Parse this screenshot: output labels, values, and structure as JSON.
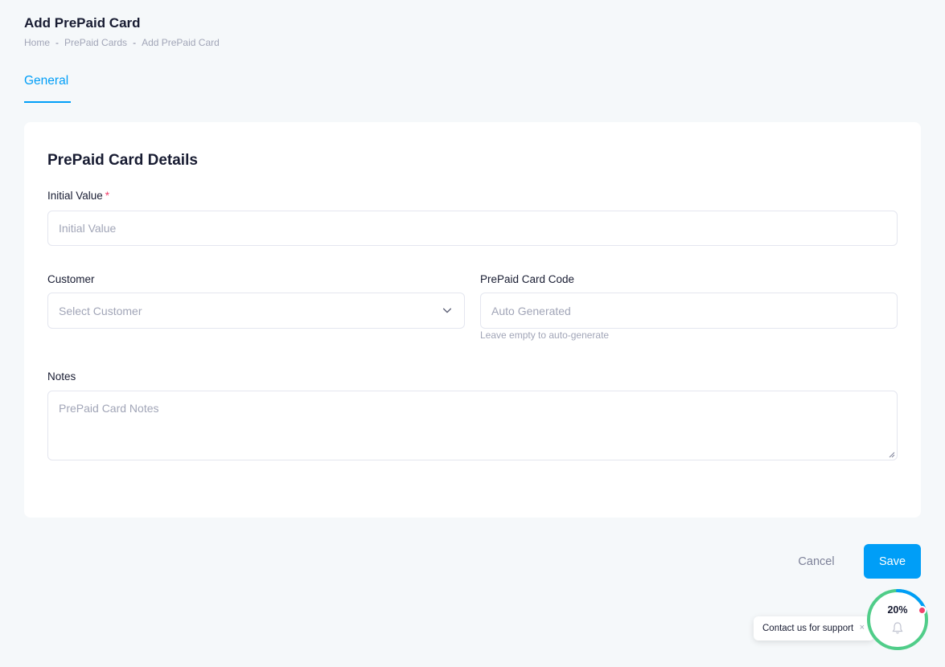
{
  "page": {
    "title": "Add PrePaid Card",
    "breadcrumb": [
      "Home",
      "PrePaid Cards",
      "Add PrePaid Card"
    ],
    "breadcrumb_separator": "-"
  },
  "tabs": [
    {
      "label": "General",
      "active": true
    }
  ],
  "card": {
    "title": "PrePaid Card Details",
    "fields": {
      "initial_value": {
        "label": "Initial Value",
        "required_mark": "*",
        "value": "",
        "placeholder": "Initial Value"
      },
      "customer": {
        "label": "Customer",
        "selected": "",
        "placeholder": "Select Customer"
      },
      "card_code": {
        "label": "PrePaid Card Code",
        "value": "",
        "placeholder": "Auto Generated",
        "hint": "Leave empty to auto-generate"
      },
      "notes": {
        "label": "Notes",
        "value": "",
        "placeholder": "PrePaid Card Notes"
      }
    }
  },
  "actions": {
    "cancel": "Cancel",
    "save": "Save"
  },
  "support": {
    "label": "Contact us for support",
    "close": "×"
  },
  "progress": {
    "value": 20,
    "text": "20%"
  },
  "icons": {
    "select": "chevron-down-icon",
    "bell": "bell-icon"
  },
  "colors": {
    "primary": "#009ef7",
    "required": "#f1416c",
    "progress_blue": "#009ef7",
    "progress_green": "#50cd89"
  }
}
